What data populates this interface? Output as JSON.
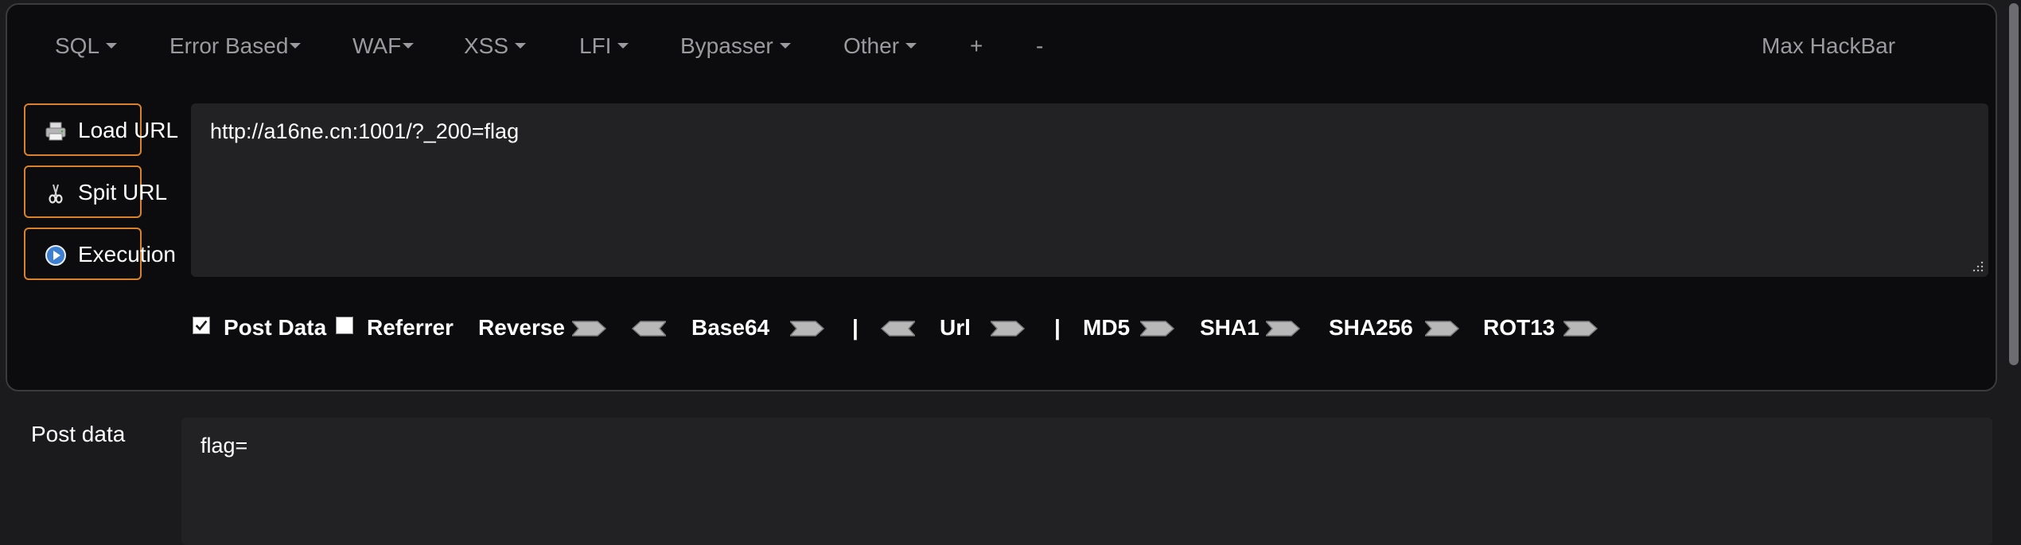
{
  "menu": {
    "items": [
      {
        "label": "SQL",
        "has_caret": true
      },
      {
        "label": "Error Based",
        "has_caret": true
      },
      {
        "label": "WAF",
        "has_caret": true
      },
      {
        "label": "XSS",
        "has_caret": true
      },
      {
        "label": "LFI",
        "has_caret": true
      },
      {
        "label": "Bypasser",
        "has_caret": true
      },
      {
        "label": "Other",
        "has_caret": true
      },
      {
        "label": "+",
        "has_caret": false
      },
      {
        "label": "-",
        "has_caret": false
      }
    ],
    "brand": "Max HackBar"
  },
  "actions": {
    "load_url": {
      "label": "Load URL",
      "icon": "printer-icon"
    },
    "split_url": {
      "label": "Spit URL",
      "icon": "scissors-icon"
    },
    "execution": {
      "label": "Execution",
      "icon": "play-circle-icon"
    }
  },
  "url": {
    "value": "http://a16ne.cn:1001/?_200=flag"
  },
  "toolbar": {
    "post_data": {
      "label": "Post Data",
      "checked": true
    },
    "referrer": {
      "label": "Referrer",
      "checked": false
    },
    "reverse": "Reverse",
    "base64": "Base64",
    "sep1": "|",
    "url": "Url",
    "sep2": "|",
    "md5": "MD5",
    "sha1": "SHA1",
    "sha256": "SHA256",
    "rot13": "ROT13"
  },
  "post": {
    "label": "Post data",
    "value": "flag="
  },
  "colors": {
    "accent": "#d9822b",
    "panel_bg": "#0c0c0e",
    "field_bg": "#222225",
    "menu_text": "#9b9b9f"
  }
}
